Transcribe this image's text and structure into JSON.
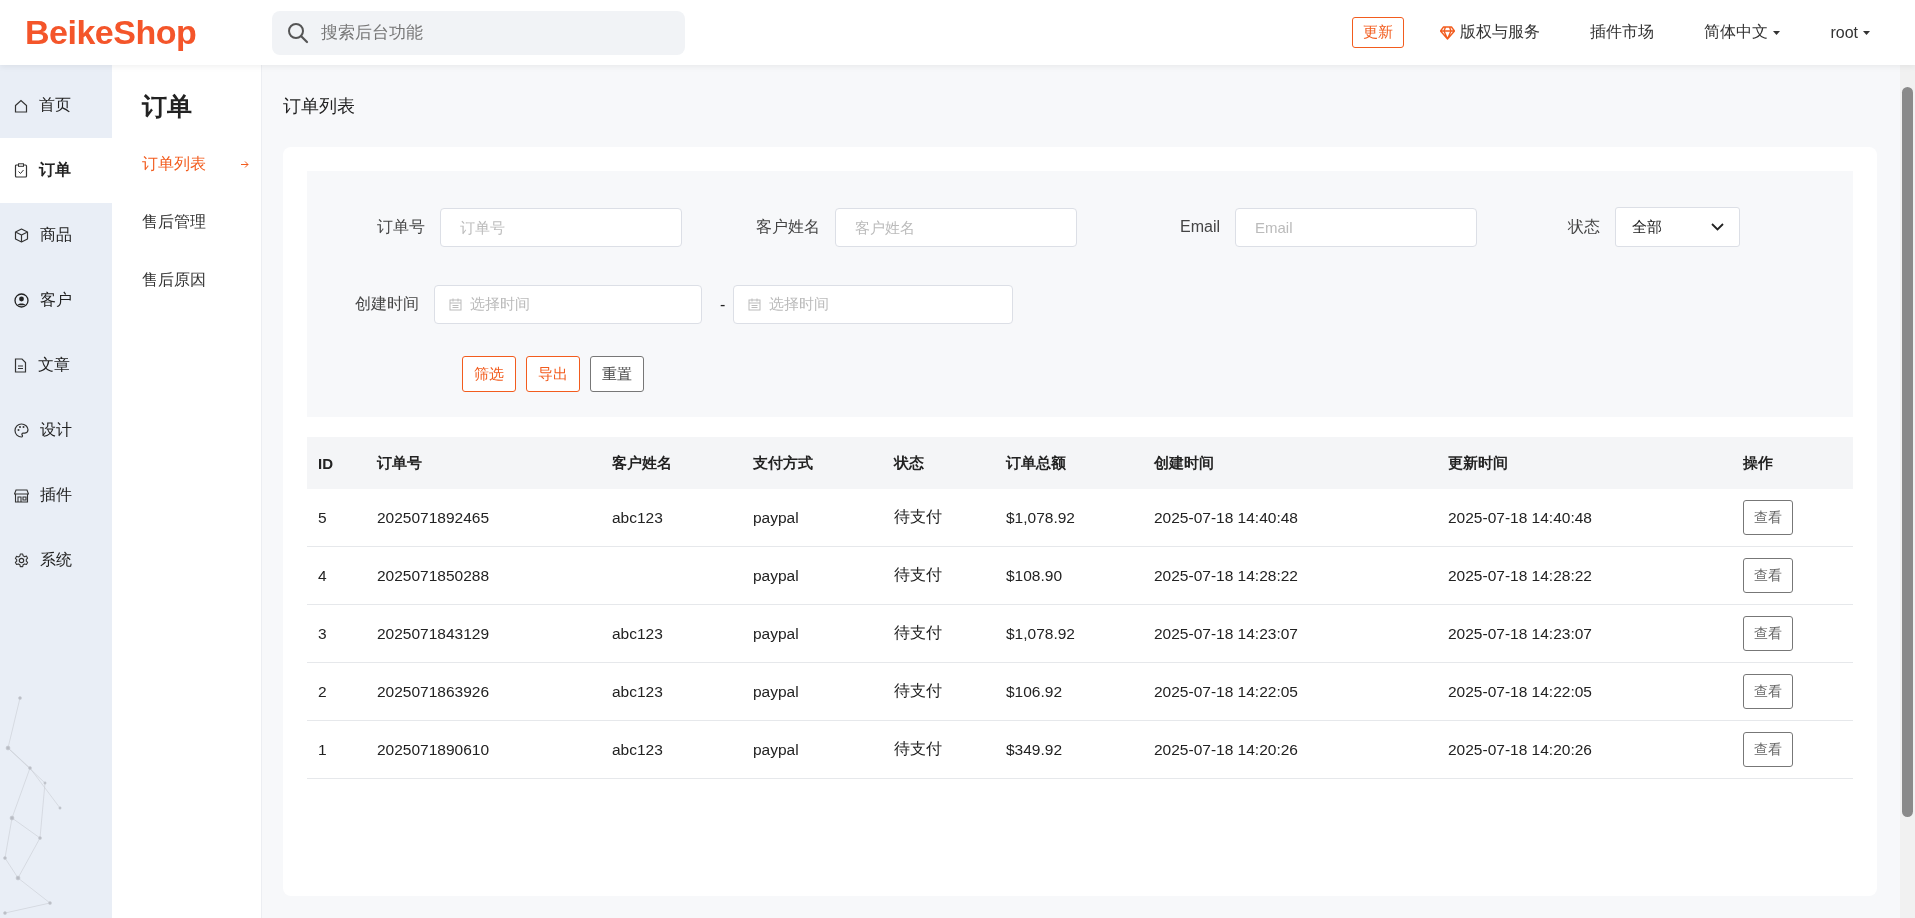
{
  "header": {
    "logo": "BeikeShop",
    "search": {
      "placeholder": "搜索后台功能"
    },
    "update_button": "更新",
    "links": [
      {
        "label": "版权与服务",
        "kind": "icon"
      },
      {
        "label": "插件市场",
        "kind": "plain"
      },
      {
        "label": "简体中文",
        "kind": "dropdown"
      },
      {
        "label": "root",
        "kind": "dropdown"
      }
    ]
  },
  "sidebar": {
    "items": [
      {
        "label": "首页",
        "selected": false
      },
      {
        "label": "订单",
        "selected": true
      },
      {
        "label": "商品",
        "selected": false
      },
      {
        "label": "客户",
        "selected": false
      },
      {
        "label": "文章",
        "selected": false
      },
      {
        "label": "设计",
        "selected": false
      },
      {
        "label": "插件",
        "selected": false
      },
      {
        "label": "系统",
        "selected": false
      }
    ]
  },
  "submenu": {
    "title": "订单",
    "items": [
      {
        "label": "订单列表",
        "selected": true
      },
      {
        "label": "售后管理",
        "selected": false
      },
      {
        "label": "售后原因",
        "selected": false
      }
    ]
  },
  "page_title": "订单列表",
  "filters": {
    "order_no": {
      "label": "订单号",
      "placeholder": "订单号"
    },
    "customer": {
      "label": "客户姓名",
      "placeholder": "客户姓名"
    },
    "email": {
      "label": "Email",
      "placeholder": "Email"
    },
    "status": {
      "label": "状态",
      "value": "全部"
    },
    "created": {
      "label": "创建时间",
      "from_placeholder": "选择时间",
      "separator": "-",
      "to_placeholder": "选择时间"
    },
    "buttons": [
      {
        "label": "筛选",
        "kind": "primary"
      },
      {
        "label": "导出",
        "kind": "primary"
      },
      {
        "label": "重置",
        "kind": "secondary"
      }
    ]
  },
  "table": {
    "columns": [
      "ID",
      "订单号",
      "客户姓名",
      "支付方式",
      "状态",
      "订单总额",
      "创建时间",
      "更新时间",
      "操作"
    ],
    "rows": [
      {
        "id": "5",
        "order_no": "2025071892465",
        "customer": "abc123",
        "payment": "paypal",
        "status": "待支付",
        "total": "$1,078.92",
        "created": "2025-07-18 14:40:48",
        "updated": "2025-07-18 14:40:48",
        "action": "查看"
      },
      {
        "id": "4",
        "order_no": "2025071850288",
        "payment": "paypal",
        "status": "待支付",
        "total": "$108.90",
        "created": "2025-07-18 14:28:22",
        "updated": "2025-07-18 14:28:22",
        "action": "查看"
      },
      {
        "id": "3",
        "order_no": "2025071843129",
        "customer": "abc123",
        "payment": "paypal",
        "status": "待支付",
        "total": "$1,078.92",
        "created": "2025-07-18 14:23:07",
        "updated": "2025-07-18 14:23:07",
        "action": "查看"
      },
      {
        "id": "2",
        "order_no": "2025071863926",
        "customer": "abc123",
        "payment": "paypal",
        "status": "待支付",
        "total": "$106.92",
        "created": "2025-07-18 14:22:05",
        "updated": "2025-07-18 14:22:05",
        "action": "查看"
      },
      {
        "id": "1",
        "order_no": "2025071890610",
        "customer": "abc123",
        "payment": "paypal",
        "status": "待支付",
        "total": "$349.92",
        "created": "2025-07-18 14:20:26",
        "updated": "2025-07-18 14:20:26",
        "action": "查看"
      }
    ]
  }
}
